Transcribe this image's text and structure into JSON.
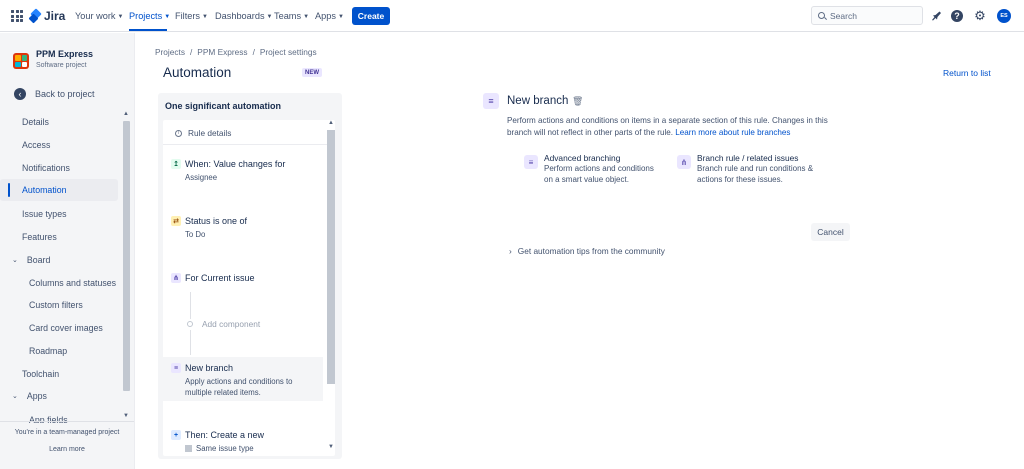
{
  "topnav": {
    "logo": "Jira",
    "items": [
      {
        "label": "Your work"
      },
      {
        "label": "Projects"
      },
      {
        "label": "Filters"
      },
      {
        "label": "Dashboards"
      },
      {
        "label": "Teams"
      },
      {
        "label": "Apps"
      }
    ],
    "create_label": "Create",
    "search_placeholder": "Search",
    "avatar_initials": "ES"
  },
  "sidebar": {
    "project_name": "PPM Express",
    "project_type": "Software project",
    "back_label": "Back to project",
    "items": [
      {
        "label": "Details"
      },
      {
        "label": "Access"
      },
      {
        "label": "Notifications"
      },
      {
        "label": "Automation"
      },
      {
        "label": "Issue types"
      },
      {
        "label": "Features"
      },
      {
        "label": "Board"
      },
      {
        "label": "Columns and statuses"
      },
      {
        "label": "Custom filters"
      },
      {
        "label": "Card cover images"
      },
      {
        "label": "Roadmap"
      },
      {
        "label": "Toolchain"
      },
      {
        "label": "Apps"
      },
      {
        "label": "App fields"
      }
    ],
    "team_note": "You're in a team-managed project",
    "learn_more": "Learn more"
  },
  "breadcrumb": [
    "Projects",
    "PPM Express",
    "Project settings"
  ],
  "page": {
    "title": "Automation",
    "badge": "NEW",
    "return_link": "Return to list"
  },
  "rule": {
    "name": "One significant automation",
    "details_label": "Rule details",
    "components": [
      {
        "title": "When: Value changes for",
        "subtitle": "Assignee"
      },
      {
        "title": "Status is one of",
        "subtitle": "To Do"
      },
      {
        "title": "For Current issue",
        "subtitle": ""
      },
      {
        "title": "New branch",
        "subtitle": "Apply actions and conditions to",
        "subtitle2": "multiple related items."
      },
      {
        "title": "Then: Create a new",
        "subtitle": "Same issue type"
      }
    ],
    "add_component": "Add component"
  },
  "detail": {
    "title": "New branch",
    "desc_prefix": "Perform actions and conditions on items in a separate section of this rule. Changes in this branch will not reflect in other parts of the rule. ",
    "desc_link": "Learn more about rule branches",
    "options": [
      {
        "title": "Advanced branching",
        "desc1": "Perform actions and conditions",
        "desc2": "on a smart value object."
      },
      {
        "title": "Branch rule / related issues",
        "desc1": "Branch rule and run conditions &",
        "desc2": "actions for these issues."
      }
    ],
    "cancel_label": "Cancel",
    "tips_label": "Get automation tips from the community"
  }
}
